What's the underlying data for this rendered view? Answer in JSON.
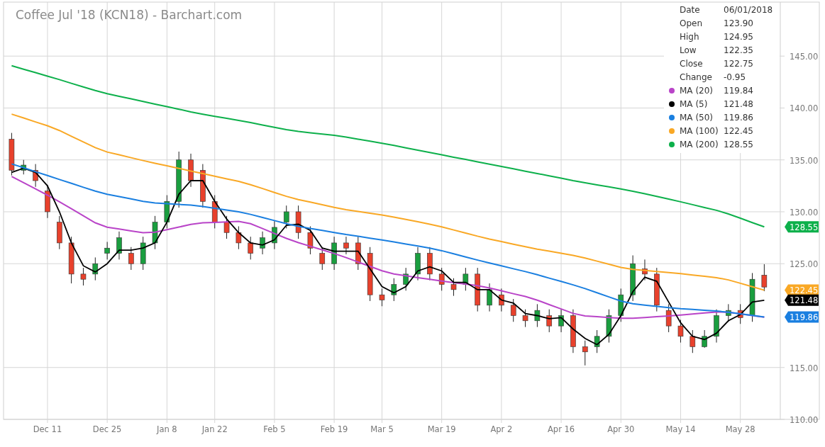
{
  "title": "Coffee Jul '18 (KCN18) - Barchart.com",
  "legend": {
    "fields": [
      {
        "label": "Date",
        "value": "06/01/2018"
      },
      {
        "label": "Open",
        "value": "123.90"
      },
      {
        "label": "High",
        "value": "124.95"
      },
      {
        "label": "Low",
        "value": "122.35"
      },
      {
        "label": "Close",
        "value": "122.75"
      },
      {
        "label": "Change",
        "value": "-0.95"
      }
    ],
    "ma_values": [
      "119.84",
      "121.48",
      "119.86",
      "122.45",
      "128.55"
    ]
  },
  "chart": {
    "chart_data": {
      "type": "candlestick",
      "grid": true,
      "ylim": [
        110,
        150.2
      ],
      "categories": [
        null,
        null,
        null,
        "Dec 11",
        null,
        null,
        null,
        null,
        "Dec 25",
        null,
        null,
        null,
        null,
        "Jan 8",
        null,
        null,
        null,
        "Jan 22",
        null,
        null,
        null,
        null,
        "Feb 5",
        null,
        null,
        null,
        null,
        "Feb 19",
        null,
        null,
        null,
        "Mar 5",
        null,
        null,
        null,
        null,
        "Mar 19",
        null,
        null,
        null,
        null,
        "Apr 2",
        null,
        null,
        null,
        null,
        "Apr 16",
        null,
        null,
        null,
        null,
        "Apr 30",
        null,
        null,
        null,
        null,
        "May 14",
        null,
        null,
        null,
        null,
        "May 28",
        null,
        null
      ],
      "ohlc": [
        [
          137,
          137.6,
          133.5,
          134
        ],
        [
          134,
          135,
          133.6,
          134.5
        ],
        [
          134,
          134.6,
          132.4,
          133
        ],
        [
          132,
          132.6,
          129.4,
          130
        ],
        [
          129,
          129.6,
          126.4,
          127
        ],
        [
          127,
          127.6,
          123.1,
          124
        ],
        [
          124,
          124.6,
          122.9,
          123.5
        ],
        [
          124,
          125.6,
          123.4,
          125
        ],
        [
          126,
          127.1,
          125.4,
          126.5
        ],
        [
          126,
          128.1,
          125.4,
          127.5
        ],
        [
          126,
          126.6,
          124.4,
          125
        ],
        [
          125,
          127.6,
          124.4,
          127
        ],
        [
          127,
          129.6,
          126.4,
          129
        ],
        [
          129,
          131.6,
          128.4,
          131
        ],
        [
          131,
          135.8,
          130.4,
          135
        ],
        [
          135,
          135.6,
          132.4,
          133
        ],
        [
          134,
          134.6,
          130.4,
          131
        ],
        [
          131,
          131.6,
          128.4,
          129
        ],
        [
          129,
          129.6,
          127.4,
          128
        ],
        [
          128,
          128.6,
          126.4,
          127
        ],
        [
          127,
          127.6,
          125.4,
          126
        ],
        [
          126.5,
          128.1,
          125.9,
          127.5
        ],
        [
          127,
          129.1,
          126.4,
          128.5
        ],
        [
          129,
          130.6,
          128.4,
          130
        ],
        [
          130,
          130.6,
          127.4,
          128
        ],
        [
          128,
          128.6,
          125.9,
          126.5
        ],
        [
          126,
          126.6,
          124.4,
          125
        ],
        [
          125,
          127.6,
          124.4,
          127
        ],
        [
          127,
          127.6,
          125.9,
          126.5
        ],
        [
          127,
          127.6,
          124.4,
          125
        ],
        [
          126,
          126.6,
          121.4,
          122
        ],
        [
          122,
          122.6,
          120.9,
          121.5
        ],
        [
          122,
          123.6,
          121.4,
          123
        ],
        [
          123,
          124.6,
          122.4,
          124
        ],
        [
          124,
          126.6,
          123.4,
          126
        ],
        [
          126,
          126.6,
          123.4,
          124
        ],
        [
          124,
          124.6,
          122.4,
          123
        ],
        [
          123,
          123.6,
          121.9,
          122.5
        ],
        [
          123,
          124.6,
          122.4,
          124
        ],
        [
          124,
          124.6,
          120.4,
          121
        ],
        [
          121,
          123.1,
          120.4,
          122.5
        ],
        [
          122,
          122.6,
          120.4,
          121
        ],
        [
          121,
          121.6,
          119.4,
          120
        ],
        [
          120,
          120.6,
          118.9,
          119.5
        ],
        [
          119.5,
          121.1,
          118.9,
          120.5
        ],
        [
          120,
          120.6,
          118.4,
          119
        ],
        [
          119,
          120.6,
          118.4,
          120
        ],
        [
          120,
          120.6,
          116.4,
          117
        ],
        [
          117,
          117.6,
          115.2,
          116.5
        ],
        [
          117,
          118.6,
          116.4,
          118
        ],
        [
          118,
          120.6,
          117.4,
          120
        ],
        [
          120,
          122.6,
          119.4,
          122
        ],
        [
          122,
          125.8,
          121.4,
          125
        ],
        [
          124.5,
          125.4,
          123.4,
          124
        ],
        [
          124,
          124.6,
          120.4,
          121
        ],
        [
          120.5,
          121.1,
          118.4,
          119
        ],
        [
          119,
          119.6,
          117.4,
          118
        ],
        [
          118,
          118.6,
          116.4,
          117
        ],
        [
          117,
          118.6,
          116.9,
          118
        ],
        [
          118,
          120.6,
          117.4,
          120
        ],
        [
          120,
          121.1,
          119.4,
          120.5
        ],
        [
          120.5,
          121.1,
          119.2,
          119.8
        ],
        [
          120,
          124.1,
          119.4,
          123.5
        ],
        [
          123.9,
          124.95,
          122.35,
          122.75
        ]
      ],
      "series": [
        {
          "name": "MA (20)",
          "color": "#b944c8",
          "type": "line",
          "values": [
            133.4,
            132.8,
            132.2,
            131.6,
            130.96,
            130.29,
            129.61,
            128.94,
            128.51,
            128.34,
            128.16,
            127.99,
            128.03,
            128.28,
            128.53,
            128.78,
            128.93,
            128.98,
            129.03,
            129.08,
            128.86,
            128.39,
            127.91,
            127.44,
            127.03,
            126.68,
            126.33,
            125.98,
            125.59,
            125.16,
            124.74,
            124.31,
            124.01,
            123.84,
            123.66,
            123.49,
            123.33,
            123.18,
            123.03,
            122.88,
            122.66,
            122.39,
            122.11,
            121.84,
            121.49,
            121.06,
            120.64,
            120.21,
            119.96,
            119.89,
            119.81,
            119.74,
            119.74,
            119.81,
            119.89,
            119.96,
            120.05,
            120.15,
            120.25,
            120.35,
            120.32,
            120.16,
            120.0,
            119.84
          ]
        },
        {
          "name": "MA (5)",
          "color": "#000000",
          "type": "line",
          "values": [
            133.8,
            134.2,
            133.8,
            132.5,
            130,
            127,
            124.8,
            124.2,
            125,
            126.3,
            126.3,
            126.5,
            127,
            129,
            131.7,
            133,
            133,
            131,
            129.3,
            128,
            127,
            126.8,
            127.3,
            128.7,
            128.8,
            128.2,
            126.5,
            126.2,
            126.2,
            126.2,
            124.5,
            122.8,
            122.2,
            122.8,
            124.3,
            124.7,
            124.3,
            123.2,
            123.2,
            122.5,
            122.5,
            121.5,
            121.2,
            120.2,
            120,
            119.7,
            119.8,
            118.7,
            117.8,
            117.2,
            118.2,
            120,
            122.3,
            123.7,
            123.3,
            121.3,
            119.3,
            118,
            117.7,
            118.3,
            119.5,
            120.1,
            121.3,
            121.48
          ]
        },
        {
          "name": "MA (50)",
          "color": "#1a7fe0",
          "type": "line",
          "values": [
            134.61,
            134.24,
            133.86,
            133.49,
            133.11,
            132.74,
            132.36,
            131.99,
            131.69,
            131.46,
            131.24,
            131.01,
            130.86,
            130.79,
            130.71,
            130.64,
            130.51,
            130.34,
            130.16,
            129.99,
            129.75,
            129.45,
            129.15,
            128.85,
            128.6,
            128.4,
            128.2,
            128.0,
            127.81,
            127.64,
            127.46,
            127.29,
            127.1,
            126.9,
            126.7,
            126.5,
            126.25,
            125.95,
            125.65,
            125.35,
            125.06,
            124.79,
            124.51,
            124.24,
            123.94,
            123.61,
            123.29,
            122.96,
            122.6,
            122.2,
            121.8,
            121.4,
            121.14,
            121.01,
            120.89,
            120.76,
            120.66,
            120.59,
            120.51,
            120.44,
            120.32,
            120.17,
            120.01,
            119.86
          ]
        },
        {
          "name": "MA (100)",
          "color": "#f9a825",
          "type": "line",
          "values": [
            139.41,
            139.04,
            138.66,
            138.29,
            137.83,
            137.28,
            136.73,
            136.18,
            135.76,
            135.49,
            135.21,
            134.94,
            134.68,
            134.43,
            134.18,
            133.93,
            133.68,
            133.43,
            133.18,
            132.93,
            132.61,
            132.24,
            131.86,
            131.49,
            131.18,
            130.93,
            130.68,
            130.43,
            130.21,
            130.04,
            129.86,
            129.69,
            129.49,
            129.26,
            129.04,
            128.81,
            128.55,
            128.25,
            127.95,
            127.65,
            127.38,
            127.13,
            126.88,
            126.63,
            126.4,
            126.2,
            126.0,
            125.8,
            125.55,
            125.25,
            124.95,
            124.65,
            124.45,
            124.35,
            124.25,
            124.15,
            124.04,
            123.91,
            123.79,
            123.66,
            123.44,
            123.11,
            122.78,
            122.45
          ]
        },
        {
          "name": "MA (200)",
          "color": "#0db04b",
          "type": "line",
          "values": [
            144.08,
            143.74,
            143.41,
            143.07,
            142.73,
            142.38,
            142.03,
            141.68,
            141.38,
            141.13,
            140.88,
            140.63,
            140.38,
            140.13,
            139.88,
            139.63,
            139.4,
            139.2,
            139.0,
            138.8,
            138.59,
            138.36,
            138.14,
            137.91,
            137.74,
            137.61,
            137.49,
            137.36,
            137.2,
            137.0,
            136.8,
            136.6,
            136.39,
            136.16,
            135.94,
            135.71,
            135.49,
            135.26,
            135.04,
            134.81,
            134.59,
            134.36,
            134.14,
            133.91,
            133.69,
            133.46,
            133.24,
            133.01,
            132.8,
            132.6,
            132.4,
            132.2,
            131.98,
            131.73,
            131.48,
            131.23,
            130.96,
            130.69,
            130.41,
            130.14,
            129.79,
            129.38,
            128.96,
            128.55
          ]
        }
      ],
      "yticks": [
        {
          "value": 110,
          "label": "110.00"
        },
        {
          "value": 115,
          "label": "115.00"
        },
        {
          "value": 125,
          "label": "125.00"
        },
        {
          "value": 130,
          "label": "130.00"
        },
        {
          "value": 135,
          "label": "135.00"
        },
        {
          "value": 140,
          "label": "140.00"
        },
        {
          "value": 145,
          "label": "145.00"
        }
      ]
    },
    "price_tags": [
      {
        "label": "128.55",
        "color": "#0db04b"
      },
      {
        "label": "122.45",
        "color": "#f9a825"
      },
      {
        "label": "121.48",
        "color": "#000000"
      },
      {
        "label": "119.86",
        "color": "#1a7fe0"
      }
    ]
  }
}
